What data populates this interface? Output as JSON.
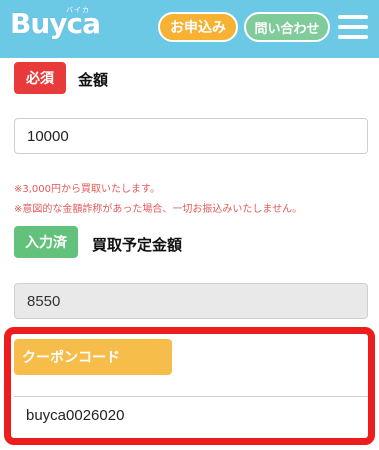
{
  "header": {
    "logo": "Buyca",
    "logo_sub": "バイカ",
    "apply_label": "お申込み",
    "contact_label": "問い合わせ"
  },
  "amount": {
    "badge": "必須",
    "label": "金額",
    "value": "10000"
  },
  "notes": [
    "※3,000円から買取いたします。",
    "※意図的な金額詐称があった場合、一切お振込みいたしません。"
  ],
  "purchase": {
    "badge": "入力済",
    "label": "買取予定金額",
    "value": "8550"
  },
  "coupon": {
    "badge": "クーポンコード",
    "value": "buyca0026020"
  },
  "colors": {
    "header_bg": "#6cc9e6",
    "required_badge": "#e83a3a",
    "filled_badge": "#62c17a",
    "coupon_badge": "#f7bd4b",
    "highlight_border": "#ee1d1d"
  }
}
